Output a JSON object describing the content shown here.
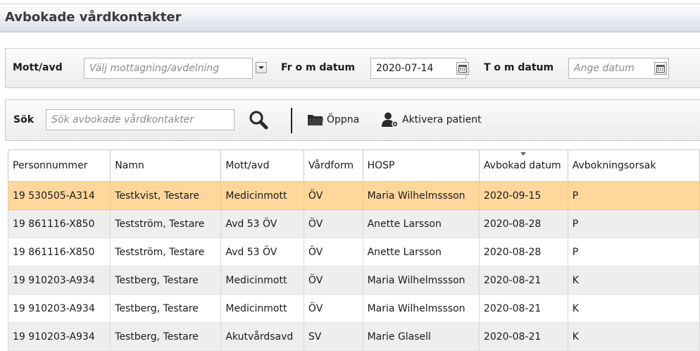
{
  "header": {
    "title": "Avbokade vårdkontakter"
  },
  "filters": {
    "unit_label": "Mott/avd",
    "unit_placeholder": "Välj mottagning/avdelning",
    "from_label": "Fr o m datum",
    "from_value": "2020-07-14",
    "to_label": "T o m datum",
    "to_placeholder": "Ange datum"
  },
  "toolbar": {
    "search_label": "Sök",
    "search_placeholder": "Sök avbokade vårdkontakter",
    "open_label": "Öppna",
    "activate_label": "Aktivera patient"
  },
  "table": {
    "columns": [
      "Personnummer",
      "Namn",
      "Mott/avd",
      "Vårdform",
      "HOSP",
      "Avbokad datum",
      "Avbokningsorsak"
    ],
    "rows": [
      [
        "19 530505-A314",
        "Testkvist, Testare",
        "Medicinmott",
        "ÖV",
        "Maria Wilhelmssson",
        "2020-09-15",
        "P"
      ],
      [
        "19 861116-X850",
        "Testström, Testare",
        "Avd 53 ÖV",
        "ÖV",
        "Anette Larsson",
        "2020-08-28",
        "P"
      ],
      [
        "19 861116-X850",
        "Testström, Testare",
        "Avd 53 ÖV",
        "ÖV",
        "Anette Larsson",
        "2020-08-28",
        "P"
      ],
      [
        "19 910203-A934",
        "Testberg, Testare",
        "Medicinmott",
        "ÖV",
        "Maria Wilhelmssson",
        "2020-08-21",
        "K"
      ],
      [
        "19 910203-A934",
        "Testberg, Testare",
        "Medicinmott",
        "ÖV",
        "Maria Wilhelmssson",
        "2020-08-21",
        "K"
      ],
      [
        "19 910203-A934",
        "Testberg, Testare",
        "Akutvårdsavd",
        "SV",
        "Marie Glasell",
        "2020-08-21",
        "K"
      ]
    ]
  },
  "icons": {
    "dropdown": "chevron-down-icon",
    "calendar": "calendar-icon",
    "search": "search-icon",
    "folder": "folder-icon",
    "user": "user-gear-icon"
  },
  "colors": {
    "selected_row": "#ffd79c",
    "alt_row": "#eeeeee"
  }
}
